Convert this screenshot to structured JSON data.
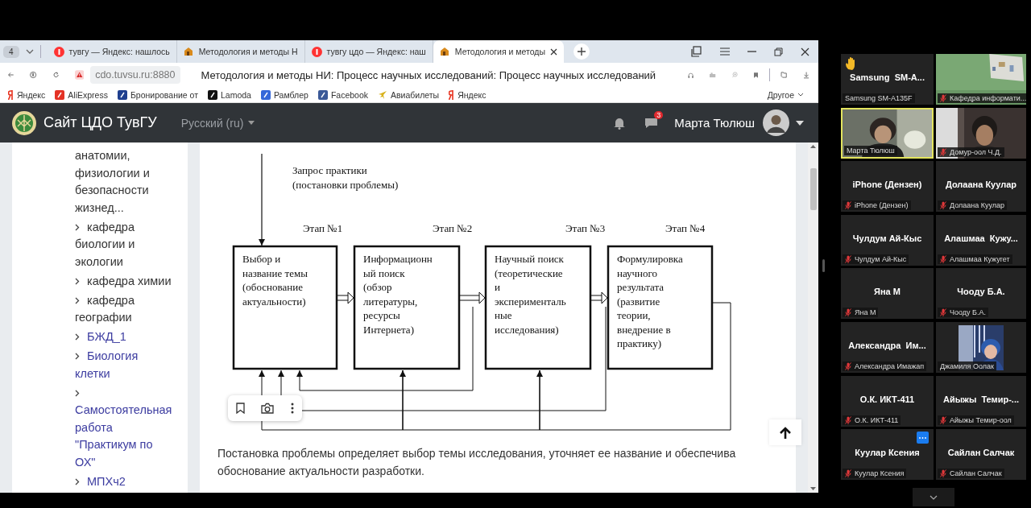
{
  "browser": {
    "tab_count": "4",
    "tabs": [
      {
        "title": "тувгу — Яндекс: нашлось",
        "selected": false
      },
      {
        "title": "Методология и методы Н",
        "selected": false
      },
      {
        "title": "тувгу цдо — Яндекс: наш",
        "selected": false
      },
      {
        "title": "Методология и методы",
        "selected": true
      }
    ],
    "address": "cdo.tuvsu.ru:8880",
    "page_title": "Методология и методы НИ: Процесс научных исследований: Процесс научных исследований",
    "bookmarks": [
      {
        "label": "Яндекс"
      },
      {
        "label": "AliExpress"
      },
      {
        "label": "Бронирование от"
      },
      {
        "label": "Lamoda"
      },
      {
        "label": "Рамблер"
      },
      {
        "label": "Facebook"
      },
      {
        "label": "Авиабилеты"
      },
      {
        "label": "Яндекс"
      }
    ],
    "bookmarks_more": "Другое"
  },
  "site": {
    "title": "Сайт ЦДО ТувГУ",
    "language": "Русский (ru)",
    "messages_badge": "3",
    "user": "Марта Тюлюш"
  },
  "sidebar": [
    {
      "text": "анатомии, физиологии и безопасности жизнед...",
      "link": false,
      "chevron": false
    },
    {
      "text": "кафедра биологии и экологии",
      "link": false,
      "chevron": true
    },
    {
      "text": "кафедра химии",
      "link": false,
      "chevron": true
    },
    {
      "text": "кафедра географии",
      "link": false,
      "chevron": true
    },
    {
      "text": "БЖД_1",
      "link": true,
      "chevron": true
    },
    {
      "text": "Биология клетки",
      "link": true,
      "chevron": true
    },
    {
      "text": "Самостоятельная работа \"Практикум по ОХ\"",
      "link": true,
      "chevron": true
    },
    {
      "text": "МПХч2",
      "link": true,
      "chevron": true
    }
  ],
  "diagram": {
    "request": [
      "Запрос практики",
      "(постановки проблемы)"
    ],
    "stages": [
      {
        "label": "Этап №1",
        "lines": [
          "Выбор и",
          "название темы",
          "(обоснование",
          "актуальности)"
        ]
      },
      {
        "label": "Этап №2",
        "lines": [
          "Информационн",
          "ый поиск",
          "(обзор",
          "литературы,",
          "ресурсы",
          "Интернета)"
        ]
      },
      {
        "label": "Этап №3",
        "lines": [
          "Научный поиск",
          "(теоретические",
          "и",
          "эксперименталь",
          "ные",
          "исследования)"
        ]
      },
      {
        "label": "Этап №4",
        "lines": [
          "Формулировка",
          "научного",
          "результата",
          "(развитие",
          "теории,",
          "внедрение в",
          "практику)"
        ]
      }
    ]
  },
  "paragraph": [
    "Постановка проблемы определяет выбор темы исследования, уточняет ее название и обеспечива",
    "обоснование актуальности разработки."
  ],
  "participants": [
    {
      "kind": "name",
      "display_name": "Samsung  SM-A...",
      "label": "Samsung SM-A135F",
      "muted": false,
      "speaking": false,
      "hand": true,
      "menu": false
    },
    {
      "kind": "video",
      "label": "Кафедра информати...",
      "muted": true,
      "speaking": false,
      "hand": false,
      "menu": false
    },
    {
      "kind": "video",
      "label": "Марта Тюлюш",
      "muted": false,
      "speaking": true,
      "hand": false,
      "menu": false
    },
    {
      "kind": "video",
      "label": "Домур-оол Ч.Д.",
      "muted": true,
      "speaking": false,
      "hand": false,
      "menu": false
    },
    {
      "kind": "name",
      "display_name": "iPhone (Дензен)",
      "label": "iPhone (Дензен)",
      "muted": true,
      "speaking": false,
      "hand": false,
      "menu": false
    },
    {
      "kind": "name",
      "display_name": "Долаана Куулар",
      "label": "Долаана Куулар",
      "muted": true,
      "speaking": false,
      "hand": false,
      "menu": false
    },
    {
      "kind": "name",
      "display_name": "Чулдум Ай-Кыс",
      "label": "Чулдум Ай-Кыс",
      "muted": true,
      "speaking": false,
      "hand": false,
      "menu": false
    },
    {
      "kind": "name",
      "display_name": "Алашмаа  Кужу...",
      "label": "Алашмаа Кужугет",
      "muted": true,
      "speaking": false,
      "hand": false,
      "menu": false
    },
    {
      "kind": "name",
      "display_name": "Яна М",
      "label": "Яна М",
      "muted": true,
      "speaking": false,
      "hand": false,
      "menu": false
    },
    {
      "kind": "name",
      "display_name": "Чооду Б.А.",
      "label": "Чооду Б.А.",
      "muted": true,
      "speaking": false,
      "hand": false,
      "menu": false
    },
    {
      "kind": "name",
      "display_name": "Александра  Им...",
      "label": "Александра Имажап",
      "muted": true,
      "speaking": false,
      "hand": false,
      "menu": false
    },
    {
      "label": "Джамиля Оолак",
      "muted": false,
      "speaking": false,
      "hand": false,
      "menu": false
    },
    {
      "kind": "name",
      "display_name": "О.К. ИКТ-411",
      "label": "О.К. ИКТ-411",
      "muted": true,
      "speaking": false,
      "hand": false,
      "menu": false
    },
    {
      "kind": "name",
      "display_name": "Айыжы  Темир-...",
      "label": "Айыжы Темир-оол",
      "muted": true,
      "speaking": false,
      "hand": false,
      "menu": false
    },
    {
      "kind": "name",
      "display_name": "Куулар Ксения",
      "label": "Куулар Ксения",
      "muted": true,
      "speaking": false,
      "hand": false,
      "menu": true
    },
    {
      "kind": "name",
      "display_name": "Сайлан Салчак",
      "label": "Сайлан Салчак",
      "muted": true,
      "speaking": false,
      "hand": false,
      "menu": false
    }
  ]
}
